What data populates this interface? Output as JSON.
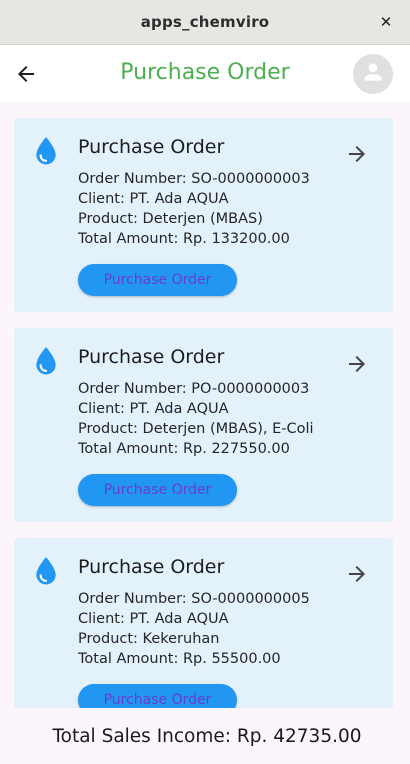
{
  "window": {
    "title": "apps_chemviro",
    "close_glyph": "✕"
  },
  "appbar": {
    "title": "Purchase Order",
    "back_icon": "arrow-back-icon",
    "avatar_icon": "person-icon"
  },
  "colors": {
    "accent_green": "#4caf50",
    "card_bg": "#e3f1fb",
    "button_blue": "#2196f3",
    "button_text": "#6a3fc6",
    "icon_blue": "#2196f3",
    "page_bg": "#fcf5fc"
  },
  "orders": [
    {
      "title": "Purchase Order",
      "order_number": "Order Number: SO-0000000003",
      "client": "Client: PT. Ada AQUA",
      "product": "Product: Deterjen (MBAS)",
      "total": "Total Amount: Rp. 133200.00",
      "button": "Purchase Order"
    },
    {
      "title": "Purchase Order",
      "order_number": "Order Number: PO-0000000003",
      "client": "Client: PT. Ada AQUA",
      "product": "Product: Deterjen (MBAS), E-Coli",
      "total": "Total Amount: Rp. 227550.00",
      "button": "Purchase Order"
    },
    {
      "title": "Purchase Order",
      "order_number": "Order Number: SO-0000000005",
      "client": "Client: PT. Ada AQUA",
      "product": "Product: Kekeruhan",
      "total": "Total Amount: Rp. 55500.00",
      "button": "Purchase Order"
    }
  ],
  "footer": {
    "total_sales": "Total Sales Income: Rp. 42735.00"
  }
}
